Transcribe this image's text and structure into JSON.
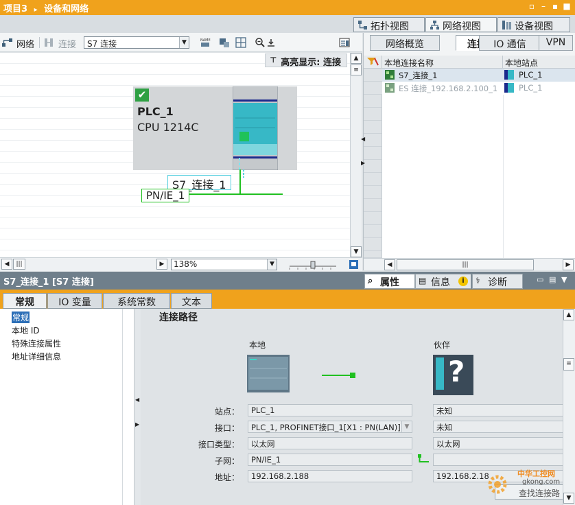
{
  "titlebar": {
    "project": "项目3",
    "separator": "▸",
    "section": "设备和网络"
  },
  "view_tabs": [
    {
      "label": "拓扑视图",
      "icon": "topology-icon"
    },
    {
      "label": "网络视图",
      "icon": "network-icon",
      "active": true
    },
    {
      "label": "设备视图",
      "icon": "device-icon"
    }
  ],
  "toolbar": {
    "network_label": "网络",
    "connection_label": "连接",
    "connection_type": "S7 连接"
  },
  "canvas": {
    "highlight_label": "高亮显示: 连接",
    "plc_name": "PLC_1",
    "plc_type": "CPU 1214C",
    "connection_label": "S7_连接_1",
    "subnet_label": "PN/IE_1",
    "zoom": "138%"
  },
  "right_panel": {
    "tabs": [
      "网络概览",
      "连接",
      "IO 通信",
      "VPN"
    ],
    "active_tab": "连接",
    "columns": [
      "本地连接名称",
      "本地站点"
    ],
    "rows": [
      {
        "name": "S7_连接_1",
        "station": "PLC_1",
        "dimmed": false
      },
      {
        "name": "ES 连接_192.168.2.100_1",
        "station": "PLC_1",
        "dimmed": true
      }
    ]
  },
  "inspector": {
    "title": "S7_连接_1 [S7 连接]",
    "tabs": [
      "属性",
      "信息",
      "诊断"
    ],
    "info_badge": "i",
    "subtabs": [
      "常规",
      "IO 变量",
      "系统常数",
      "文本"
    ],
    "nav": [
      "常规",
      "本地 ID",
      "特殊连接属性",
      "地址详细信息"
    ],
    "section_title": "连接路径",
    "local_label": "本地",
    "partner_label": "伙伴",
    "partner_icon_glyph": "?",
    "fields": {
      "station_label": "站点：",
      "interface_label": "接口：",
      "interface_type_label": "接口类型：",
      "subnet_label": "子网：",
      "address_label": "地址："
    },
    "local": {
      "station": "PLC_1",
      "interface": "PLC_1, PROFINET接口_1[X1 : PN(LAN)]",
      "interface_type": "以太网",
      "subnet": "PN/IE_1",
      "address": "192.168.2.188"
    },
    "partner": {
      "station": "未知",
      "interface": "未知",
      "interface_type": "以太网",
      "subnet": "",
      "address": "192.168.2.18"
    },
    "find_path_button": "查找连接路",
    "watermark_brand": "中华工控网",
    "watermark_url": "gkong.com"
  },
  "colors": {
    "accent": "#f0a21c",
    "link_green": "#20c020",
    "profinet_cyan": "#5bd0e0"
  }
}
